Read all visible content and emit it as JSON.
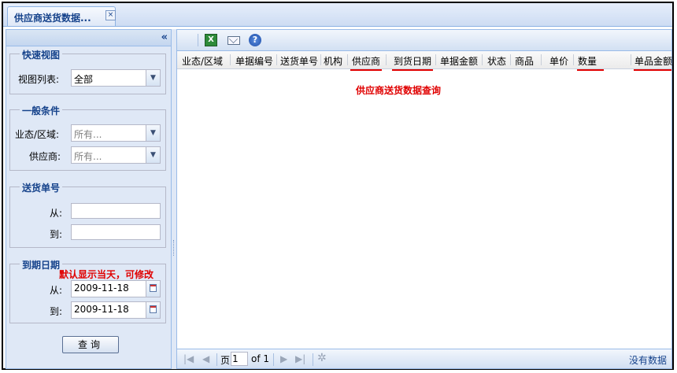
{
  "tab": {
    "title": "供应商送货数据...",
    "close": "×"
  },
  "left": {
    "collapse": "«",
    "quick_view": {
      "legend": "快速视图",
      "label": "视图列表:",
      "value": "全部"
    },
    "general": {
      "legend": "一般条件",
      "region_label": "业态/区域:",
      "region_placeholder": "所有...",
      "supplier_label": "供应商:",
      "supplier_placeholder": "所有..."
    },
    "delivery_no": {
      "legend": "送货单号",
      "from_label": "从:",
      "to_label": "到:"
    },
    "due_date": {
      "legend": "到期日期",
      "note": "默认显示当天，可修改",
      "from_label": "从:",
      "from_value": "2009-11-18",
      "to_label": "到:",
      "to_value": "2009-11-18"
    },
    "query_button": "查询"
  },
  "grid": {
    "columns": [
      "业态/区域",
      "单据编号",
      "送货单号",
      "机构",
      "供应商",
      "到货日期",
      "单据金额",
      "状态",
      "商品",
      "单价",
      "数量",
      "单品金额"
    ],
    "note": "供应商送货数据查询",
    "pager": {
      "page_label": "页",
      "page_value": "1",
      "of_label": "of 1",
      "empty": "没有数据"
    }
  },
  "colors": {
    "accent": "#15428b",
    "annotation": "#e00000",
    "panel": "#dfe8f6"
  }
}
